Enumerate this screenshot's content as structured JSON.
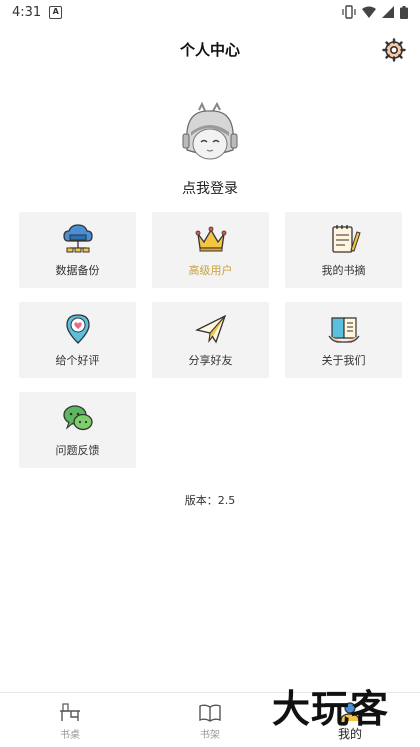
{
  "status_bar": {
    "time": "4:31",
    "notification_glyph": "A"
  },
  "header": {
    "title": "个人中心"
  },
  "profile": {
    "login_text": "点我登录"
  },
  "menu": [
    {
      "label": "数据备份",
      "icon": "cloud-server-icon"
    },
    {
      "label": "高级用户",
      "icon": "crown-icon",
      "accent": "#c9a23a"
    },
    {
      "label": "我的书摘",
      "icon": "notepad-icon"
    },
    {
      "label": "给个好评",
      "icon": "heart-pin-icon"
    },
    {
      "label": "分享好友",
      "icon": "paper-plane-icon"
    },
    {
      "label": "关于我们",
      "icon": "open-book-hands-icon"
    },
    {
      "label": "问题反馈",
      "icon": "chat-bubbles-icon"
    }
  ],
  "version_text": "版本：2.5",
  "tabbar": {
    "items": [
      {
        "label": "书桌",
        "icon": "desk-icon",
        "active": false
      },
      {
        "label": "书架",
        "icon": "bookshelf-icon",
        "active": false
      },
      {
        "label": "我的",
        "icon": "profile-icon",
        "active": true
      }
    ]
  },
  "watermark": "大玩客",
  "colors": {
    "accent_gold": "#c9a23a",
    "tile_bg": "#f3f3f3"
  }
}
